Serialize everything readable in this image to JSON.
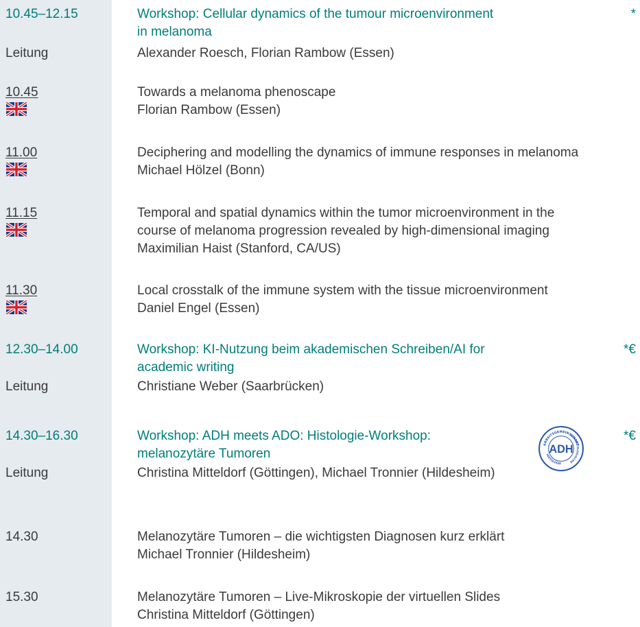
{
  "sessions": [
    {
      "time": "10.45–12.15",
      "title_line1": "Workshop: Cellular dynamics of the tumour microenvironment",
      "title_line2": "in melanoma",
      "marker": "*",
      "lead_label": "Leitung",
      "lead_names": "Alexander Roesch, Florian Rambow (Essen)"
    },
    {
      "time": "12.30–14.00",
      "title_line1": "Workshop: KI-Nutzung beim akademischen Schreiben/AI for",
      "title_line2": "academic writing",
      "marker": "*€",
      "lead_label": "Leitung",
      "lead_names": "Christiane Weber (Saarbrücken)"
    },
    {
      "time": "14.30–16.30",
      "title_line1": "Workshop: ADH meets ADO: Histologie-Workshop:",
      "title_line2": "melanozytäre Tumoren",
      "marker": "*€",
      "lead_label": "Leitung",
      "lead_names": "Christina Mitteldorf (Göttingen), Michael Tronnier (Hildesheim)",
      "logo": {
        "center_text": "ADH",
        "ring_top": "ARBEITSGEMEINSCHAFT",
        "ring_right": "DERMATOLOGISCHE",
        "ring_left": "HISTOLOGIE",
        "color": "#2b59a8"
      }
    }
  ],
  "talks": [
    {
      "time": "10.45",
      "title": "Towards a melanoma phenoscape",
      "speaker": "Florian Rambow (Essen)",
      "flag": "uk-flag-icon"
    },
    {
      "time": "11.00",
      "title": "Deciphering and modelling the dynamics of immune responses in melanoma",
      "speaker": "Michael Hölzel (Bonn)",
      "flag": "uk-flag-icon"
    },
    {
      "time": "11.15",
      "title_line1": "Temporal and spatial dynamics within the tumor microenvironment in the",
      "title_line2": "course of melanoma progression revealed by high-dimensional imaging",
      "speaker": "Maximilian Haist (Stanford, CA/US)",
      "flag": "uk-flag-icon"
    },
    {
      "time": "11.30",
      "title": "Local crosstalk of the immune system with the tissue microenvironment",
      "speaker": "Daniel Engel (Essen)",
      "flag": "uk-flag-icon"
    },
    {
      "time": "14.30",
      "title": "Melanozytäre Tumoren – die wichtigsten Diagnosen kurz erklärt",
      "speaker": "Michael Tronnier (Hildesheim)"
    },
    {
      "time": "15.30",
      "title": "Melanozytäre Tumoren – Live-Mikroskopie der virtuellen Slides",
      "speaker": "Christina Mitteldorf (Göttingen)"
    }
  ],
  "colors": {
    "accent": "#007d7a",
    "text": "#3a3a3a",
    "left_column": "#e6ebef"
  }
}
